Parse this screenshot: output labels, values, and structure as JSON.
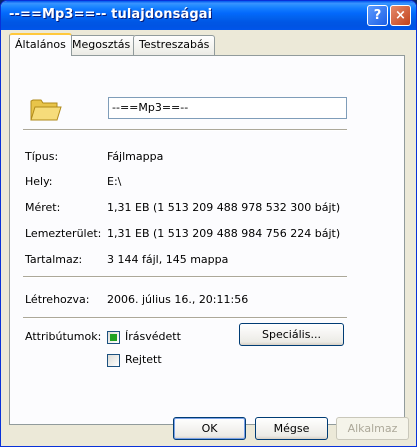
{
  "window": {
    "title": "--==Mp3==-- tulajdonságai",
    "help_glyph": "?",
    "close_glyph": "×"
  },
  "tabs": [
    {
      "label": "Általános",
      "active": true
    },
    {
      "label": "Megosztás",
      "active": false
    },
    {
      "label": "Testreszabás",
      "active": false
    }
  ],
  "general": {
    "icon": "folder-icon",
    "name": "--==Mp3==--",
    "rows": [
      {
        "label": "Típus:",
        "value": "Fájlmappa"
      },
      {
        "label": "Hely:",
        "value": "E:\\"
      },
      {
        "label": "Méret:",
        "value": "1,31 EB (1 513 209 488 978 532 300 bájt)"
      },
      {
        "label": "Lemezterület:",
        "value": "1,31 EB (1 513 209 488 984 756 224 bájt)"
      },
      {
        "label": "Tartalmaz:",
        "value": "3 144 fájl, 145 mappa"
      },
      {
        "label": "Létrehozva:",
        "value": "2006. július 16., 20:11:56"
      }
    ],
    "attributes_label": "Attribútumok:",
    "readonly": {
      "label": "Írásvédett",
      "checked": true
    },
    "hidden": {
      "label": "Rejtett",
      "checked": false
    },
    "advanced_button": "Speciális..."
  },
  "footer": {
    "ok": "OK",
    "cancel": "Mégse",
    "apply": "Alkalmaz"
  },
  "colors": {
    "titlebar": "#0054e3",
    "face": "#ece9d8",
    "tab_accent": "#ffc83c",
    "check": "#21a121"
  }
}
